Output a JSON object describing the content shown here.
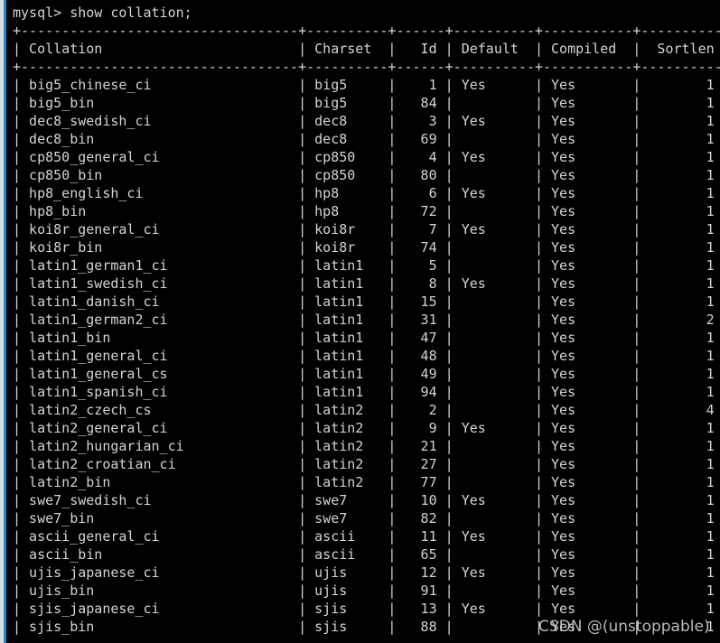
{
  "terminal": {
    "prompt_line": "mysql> show collation;",
    "prompt": "mysql>",
    "command": "show collation;",
    "background_color": "#000000",
    "text_color": "#d4d4d4",
    "border_color": "#9aa4ad",
    "accent_color": "#1e8ad6",
    "chrome_color": "#d9dde0"
  },
  "watermark": {
    "text": "CSDN @(unstoppable)"
  },
  "table": {
    "columns": [
      {
        "key": "collation",
        "label": "Collation",
        "width": 32,
        "align": "left"
      },
      {
        "key": "charset",
        "label": "Charset",
        "width": 8,
        "align": "left"
      },
      {
        "key": "id",
        "label": "Id",
        "width": 4,
        "align": "right"
      },
      {
        "key": "default",
        "label": "Default",
        "width": 8,
        "align": "left"
      },
      {
        "key": "compiled",
        "label": "Compiled",
        "width": 9,
        "align": "left"
      },
      {
        "key": "sortlen",
        "label": "Sortlen",
        "width": 8,
        "align": "right"
      }
    ],
    "rows": [
      {
        "collation": "big5_chinese_ci",
        "charset": "big5",
        "id": "1",
        "default": "Yes",
        "compiled": "Yes",
        "sortlen": "1"
      },
      {
        "collation": "big5_bin",
        "charset": "big5",
        "id": "84",
        "default": "",
        "compiled": "Yes",
        "sortlen": "1"
      },
      {
        "collation": "dec8_swedish_ci",
        "charset": "dec8",
        "id": "3",
        "default": "Yes",
        "compiled": "Yes",
        "sortlen": "1"
      },
      {
        "collation": "dec8_bin",
        "charset": "dec8",
        "id": "69",
        "default": "",
        "compiled": "Yes",
        "sortlen": "1"
      },
      {
        "collation": "cp850_general_ci",
        "charset": "cp850",
        "id": "4",
        "default": "Yes",
        "compiled": "Yes",
        "sortlen": "1"
      },
      {
        "collation": "cp850_bin",
        "charset": "cp850",
        "id": "80",
        "default": "",
        "compiled": "Yes",
        "sortlen": "1"
      },
      {
        "collation": "hp8_english_ci",
        "charset": "hp8",
        "id": "6",
        "default": "Yes",
        "compiled": "Yes",
        "sortlen": "1"
      },
      {
        "collation": "hp8_bin",
        "charset": "hp8",
        "id": "72",
        "default": "",
        "compiled": "Yes",
        "sortlen": "1"
      },
      {
        "collation": "koi8r_general_ci",
        "charset": "koi8r",
        "id": "7",
        "default": "Yes",
        "compiled": "Yes",
        "sortlen": "1"
      },
      {
        "collation": "koi8r_bin",
        "charset": "koi8r",
        "id": "74",
        "default": "",
        "compiled": "Yes",
        "sortlen": "1"
      },
      {
        "collation": "latin1_german1_ci",
        "charset": "latin1",
        "id": "5",
        "default": "",
        "compiled": "Yes",
        "sortlen": "1"
      },
      {
        "collation": "latin1_swedish_ci",
        "charset": "latin1",
        "id": "8",
        "default": "Yes",
        "compiled": "Yes",
        "sortlen": "1"
      },
      {
        "collation": "latin1_danish_ci",
        "charset": "latin1",
        "id": "15",
        "default": "",
        "compiled": "Yes",
        "sortlen": "1"
      },
      {
        "collation": "latin1_german2_ci",
        "charset": "latin1",
        "id": "31",
        "default": "",
        "compiled": "Yes",
        "sortlen": "2"
      },
      {
        "collation": "latin1_bin",
        "charset": "latin1",
        "id": "47",
        "default": "",
        "compiled": "Yes",
        "sortlen": "1"
      },
      {
        "collation": "latin1_general_ci",
        "charset": "latin1",
        "id": "48",
        "default": "",
        "compiled": "Yes",
        "sortlen": "1"
      },
      {
        "collation": "latin1_general_cs",
        "charset": "latin1",
        "id": "49",
        "default": "",
        "compiled": "Yes",
        "sortlen": "1"
      },
      {
        "collation": "latin1_spanish_ci",
        "charset": "latin1",
        "id": "94",
        "default": "",
        "compiled": "Yes",
        "sortlen": "1"
      },
      {
        "collation": "latin2_czech_cs",
        "charset": "latin2",
        "id": "2",
        "default": "",
        "compiled": "Yes",
        "sortlen": "4"
      },
      {
        "collation": "latin2_general_ci",
        "charset": "latin2",
        "id": "9",
        "default": "Yes",
        "compiled": "Yes",
        "sortlen": "1"
      },
      {
        "collation": "latin2_hungarian_ci",
        "charset": "latin2",
        "id": "21",
        "default": "",
        "compiled": "Yes",
        "sortlen": "1"
      },
      {
        "collation": "latin2_croatian_ci",
        "charset": "latin2",
        "id": "27",
        "default": "",
        "compiled": "Yes",
        "sortlen": "1"
      },
      {
        "collation": "latin2_bin",
        "charset": "latin2",
        "id": "77",
        "default": "",
        "compiled": "Yes",
        "sortlen": "1"
      },
      {
        "collation": "swe7_swedish_ci",
        "charset": "swe7",
        "id": "10",
        "default": "Yes",
        "compiled": "Yes",
        "sortlen": "1"
      },
      {
        "collation": "swe7_bin",
        "charset": "swe7",
        "id": "82",
        "default": "",
        "compiled": "Yes",
        "sortlen": "1"
      },
      {
        "collation": "ascii_general_ci",
        "charset": "ascii",
        "id": "11",
        "default": "Yes",
        "compiled": "Yes",
        "sortlen": "1"
      },
      {
        "collation": "ascii_bin",
        "charset": "ascii",
        "id": "65",
        "default": "",
        "compiled": "Yes",
        "sortlen": "1"
      },
      {
        "collation": "ujis_japanese_ci",
        "charset": "ujis",
        "id": "12",
        "default": "Yes",
        "compiled": "Yes",
        "sortlen": "1"
      },
      {
        "collation": "ujis_bin",
        "charset": "ujis",
        "id": "91",
        "default": "",
        "compiled": "Yes",
        "sortlen": "1"
      },
      {
        "collation": "sjis_japanese_ci",
        "charset": "sjis",
        "id": "13",
        "default": "Yes",
        "compiled": "Yes",
        "sortlen": "1"
      },
      {
        "collation": "sjis_bin",
        "charset": "sjis",
        "id": "88",
        "default": "",
        "compiled": "Yes",
        "sortlen": "1"
      }
    ]
  }
}
